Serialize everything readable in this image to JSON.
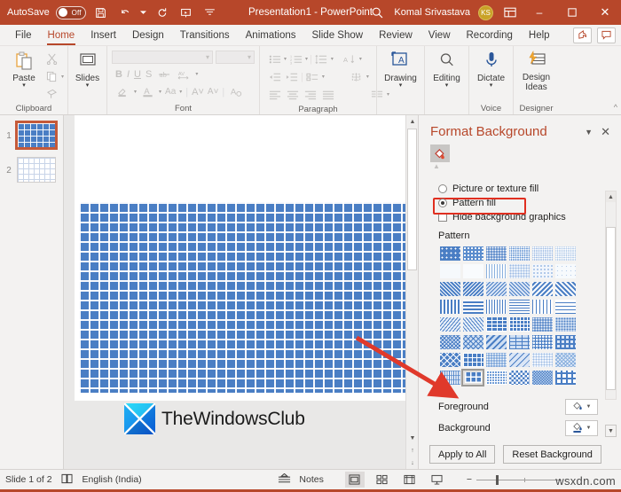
{
  "titlebar": {
    "autosave_label": "AutoSave",
    "autosave_state": "Off",
    "title": "Presentation1  -  PowerPoint",
    "user_name": "Komal Srivastava",
    "avatar_initials": "KS",
    "quick_access": [
      "save-icon",
      "undo-icon",
      "redo-icon",
      "present-icon",
      "customize-icon"
    ],
    "search_icon": "search-icon",
    "ribbon_display_icon": "ribbon-display-options-icon",
    "minimize": "–",
    "maximize": "▫",
    "close": "✕"
  },
  "tabs": [
    {
      "label": "File",
      "active": false
    },
    {
      "label": "Home",
      "active": true
    },
    {
      "label": "Insert",
      "active": false
    },
    {
      "label": "Design",
      "active": false
    },
    {
      "label": "Transitions",
      "active": false
    },
    {
      "label": "Animations",
      "active": false
    },
    {
      "label": "Slide Show",
      "active": false
    },
    {
      "label": "Review",
      "active": false
    },
    {
      "label": "View",
      "active": false
    },
    {
      "label": "Recording",
      "active": false
    },
    {
      "label": "Help",
      "active": false
    }
  ],
  "ribbon": {
    "groups": [
      {
        "name": "Clipboard",
        "label": "Clipboard"
      },
      {
        "name": "Slides",
        "label": "Slides"
      },
      {
        "name": "Font",
        "label": "Font"
      },
      {
        "name": "Paragraph",
        "label": "Paragraph"
      },
      {
        "name": "Drawing",
        "label": ""
      },
      {
        "name": "Editing",
        "label": ""
      },
      {
        "name": "Voice",
        "label": "Voice"
      },
      {
        "name": "Designer",
        "label": "Designer"
      }
    ],
    "paste_label": "Paste",
    "slides_label": "Slides",
    "drawing_label": "Drawing",
    "editing_label": "Editing",
    "dictate_label": "Dictate",
    "design_ideas_label_1": "Design",
    "design_ideas_label_2": "Ideas",
    "clipboard_group_label": "Clipboard",
    "font_group_label": "Font",
    "paragraph_group_label": "Paragraph",
    "voice_group_label": "Voice",
    "designer_group_label": "Designer",
    "font_buttons": [
      "B",
      "I",
      "U",
      "S"
    ]
  },
  "thumbnails": [
    {
      "number": "1",
      "selected": true,
      "pattern": "blue-grid"
    },
    {
      "number": "2",
      "selected": false,
      "pattern": "light-grid"
    }
  ],
  "slide": {
    "fill_pattern": "large-grid-blue",
    "foreground_color": "#4a7ec4",
    "background_color": "#ffffff"
  },
  "watermark_logo": {
    "text": "TheWindowsClub"
  },
  "pane": {
    "title": "Format Background",
    "chevron_icon": "chevron-down-icon",
    "close_icon": "close-icon",
    "fill_tab_icon": "fill-bucket-icon",
    "options": [
      {
        "id": "picture-or-texture-fill",
        "label": "Picture or texture fill",
        "type": "radio",
        "selected": false,
        "accel": "P"
      },
      {
        "id": "pattern-fill",
        "label": "Pattern fill",
        "type": "radio",
        "selected": true,
        "accel": "a",
        "highlighted": true
      },
      {
        "id": "hide-background-graphics",
        "label": "Hide background graphics",
        "type": "checkbox",
        "selected": false,
        "accel": "H"
      }
    ],
    "pattern_section_label": "Pattern",
    "pattern_grid": {
      "rows": 8,
      "columns": 6,
      "selected_row": 8,
      "selected_column": 2,
      "swatch_color": "#4472c4"
    },
    "foreground_label": "Foreground",
    "background_label": "Background",
    "foreground_swatch": "#e02f20",
    "background_swatch": "#4a7ec4",
    "apply_to_all_label": "Apply to All",
    "reset_background_label": "Reset Background"
  },
  "annotation": {
    "arrow_color": "#e0392b",
    "points_to": "selected-pattern-swatch"
  },
  "status": {
    "slide_indicator": "Slide 1 of 2",
    "accessibility_icon": "accessibility-icon",
    "language": "English (India)",
    "notes_label": "Notes",
    "view_buttons": [
      "normal-view",
      "slide-sorter-view",
      "reading-view",
      "slide-show-view"
    ],
    "zoom_minus": "−",
    "watermark": "wsxdn.com"
  }
}
